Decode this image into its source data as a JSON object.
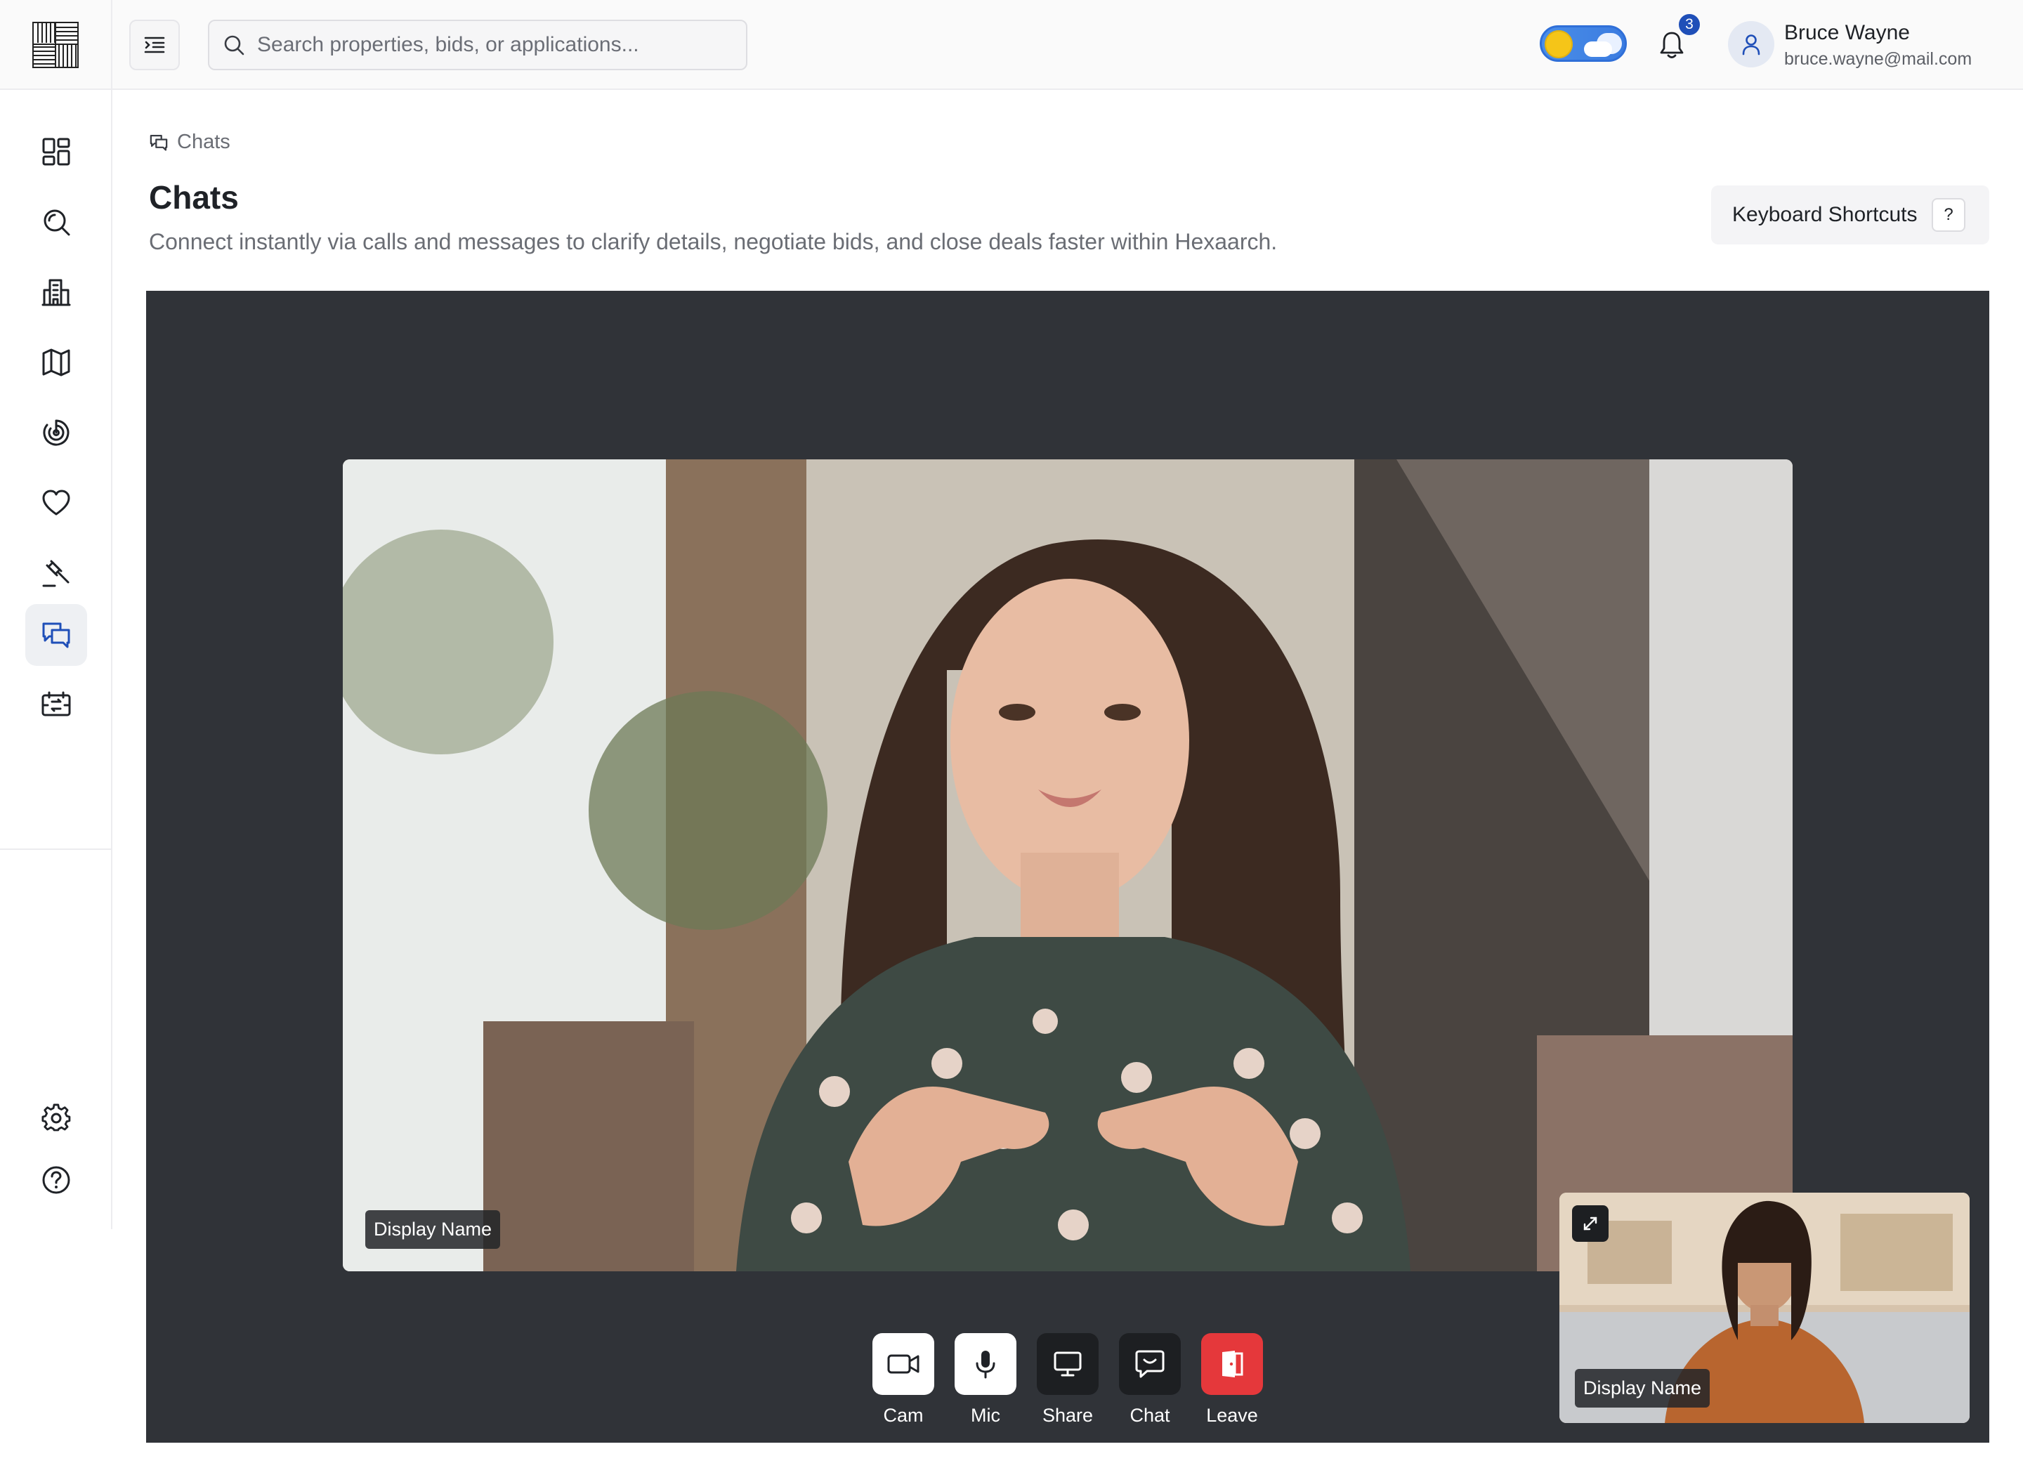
{
  "app": {
    "search_placeholder": "Search properties, bids, or applications...",
    "notification_count": "3",
    "user": {
      "name": "Bruce Wayne",
      "email": "bruce.wayne@mail.com"
    }
  },
  "sidebar": {
    "items": [
      {
        "icon": "dashboard-icon"
      },
      {
        "icon": "search-icon"
      },
      {
        "icon": "buildings-icon"
      },
      {
        "icon": "map-icon"
      },
      {
        "icon": "target-icon"
      },
      {
        "icon": "heart-icon"
      },
      {
        "icon": "gavel-icon"
      },
      {
        "icon": "chat-icon",
        "active": true
      },
      {
        "icon": "transfer-icon"
      }
    ],
    "bottom": [
      {
        "icon": "gear-icon"
      },
      {
        "icon": "help-icon"
      }
    ]
  },
  "page": {
    "breadcrumb": "Chats",
    "title": "Chats",
    "description": "Connect instantly via calls and messages to clarify details, negotiate bids, and close deals faster within Hexaarch.",
    "keyboard_shortcuts": "Keyboard Shortcuts",
    "shortcut_key": "?"
  },
  "call": {
    "main_participant": "Display Name",
    "pip_participant": "Display Name",
    "controls": [
      {
        "label": "Cam",
        "icon": "camera-icon"
      },
      {
        "label": "Mic",
        "icon": "mic-icon"
      },
      {
        "label": "Share",
        "icon": "screen-share-icon"
      },
      {
        "label": "Chat",
        "icon": "chat-bubble-icon"
      },
      {
        "label": "Leave",
        "icon": "leave-icon"
      }
    ]
  },
  "colors": {
    "accent": "#1f4fb8",
    "stage_bg": "#303338",
    "leave": "#e5383b"
  }
}
